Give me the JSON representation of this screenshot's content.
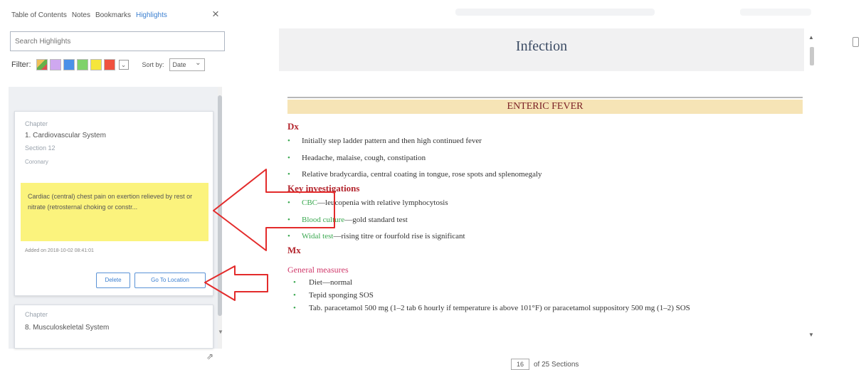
{
  "panel": {
    "tabs": [
      {
        "label": "Table of Contents",
        "active": false
      },
      {
        "label": "Notes",
        "active": false
      },
      {
        "label": "Bookmarks",
        "active": false
      },
      {
        "label": "Highlights",
        "active": true
      }
    ],
    "close_icon": "×",
    "search": {
      "placeholder": "Search Highlights",
      "value": ""
    },
    "filter": {
      "label": "Filter:",
      "swatches": [
        "multi",
        "#cfa8f0",
        "#4a90e8",
        "#7fd26a",
        "#f5e63c",
        "#f0513e"
      ],
      "sort_label": "Sort by:",
      "sort_value": "Date"
    },
    "cards": [
      {
        "chapter_key": "Chapter",
        "chapter_value": "1. Cardiovascular System",
        "section_key": "Section 12",
        "subsection": "Coronary",
        "highlight_text": "Cardiac (central) chest pain on exertion relieved by rest or nitrate (retrosternal choking or constr...",
        "added_label": "Added on 2018-10-02 08:41:01",
        "delete_label": "Delete",
        "goto_label": "Go To Location"
      },
      {
        "chapter_key": "Chapter",
        "chapter_value": "8. Musculoskeletal System"
      }
    ]
  },
  "document": {
    "chapter_title": "Infection",
    "section_title": "ENTERIC FEVER",
    "dx_heading": "Dx",
    "dx_items": [
      "Initially step ladder pattern and then high continued fever",
      "Headache, malaise, cough, constipation",
      "Relative bradycardia, central coating in tongue, rose spots and splenomegaly"
    ],
    "key_heading": "Key investigations",
    "key_items": [
      {
        "term": "CBC",
        "rest": "—leucopenia with relative lymphocytosis"
      },
      {
        "term": "Blood culture",
        "rest": "—gold standard test"
      },
      {
        "term": "Widal test",
        "rest": "—rising titre or fourfold rise is significant"
      }
    ],
    "mx_heading": "Mx",
    "general_heading": "General measures",
    "general_items": [
      "Diet—normal",
      "Tepid sponging SOS",
      "Tab. paracetamol 500 mg (1–2 tab 6 hourly if temperature is above 101°F) or paracetamol suppository 500 mg (1–2) SOS"
    ]
  },
  "pager": {
    "current": "16",
    "total_text": "of 25 Sections"
  },
  "colors": {
    "accent_blue": "#3b7fd0",
    "heading_red": "#b3242c",
    "highlight_yellow": "#fbf37d",
    "banner": "#f6e4b6",
    "annotation_arrow": "#e32b2b"
  },
  "icons": {
    "close": "close-icon",
    "resize": "resize-grip-icon",
    "sidebar_toggle": "panel-toggle-icon"
  }
}
